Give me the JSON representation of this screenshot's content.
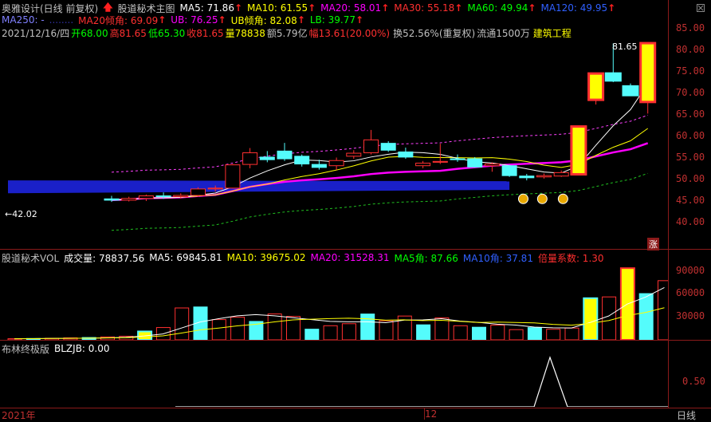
{
  "header": {
    "stock_name": "奥雅设计(日线 前复权)",
    "indicator_name": "股道秘术主图",
    "ma5": "MA5: 71.86",
    "ma10": "MA10: 61.55",
    "ma20": "MA20: 58.01",
    "ma30": "MA30: 55.18",
    "ma60": "MA60: 49.94",
    "ma120": "MA120: 49.95",
    "ma250": "MA250: -",
    "ma250_extra": "MA20倾角...",
    "ma20angle": "MA20倾角: 69.09",
    "ub": "UB: 76.25",
    "ubangle": "UB倾角: 82.08",
    "lb": "LB: 39.77",
    "colors": {
      "ma5": "#ffffff",
      "ma10": "#ffff00",
      "ma20": "#ff00ff",
      "ma30": "#ff3030",
      "ma60": "#00ff00",
      "ma120": "#3060ff",
      "ma250": "#8080ff",
      "up": "#ff3030",
      "down": "#54fcfc"
    }
  },
  "quote": {
    "date": "2021/12/16/四",
    "open": "开68.00",
    "high": "高81.65",
    "low": "低65.30",
    "close": "收81.65",
    "volume": "量78838",
    "amount": "额5.79亿",
    "change": "幅13.61(20.00%)",
    "turnover": "换52.56%(重复权)",
    "float": "流通1500万",
    "sector": "建筑工程"
  },
  "price_axis": {
    "labels": [
      "85.00",
      "80.00",
      "75.00",
      "70.00",
      "65.00",
      "60.00",
      "55.00",
      "50.00",
      "45.00",
      "40.00"
    ],
    "max_label": "81.65",
    "min_label": "42.02",
    "zhang_badge": "涨"
  },
  "chart_data": {
    "type": "candlestick",
    "x_labels": [
      "2021年",
      "12"
    ],
    "candles": [
      {
        "o": 45.5,
        "h": 46.2,
        "l": 44.8,
        "c": 45.2
      },
      {
        "o": 45.2,
        "h": 46.0,
        "l": 44.9,
        "c": 45.6
      },
      {
        "o": 45.6,
        "h": 46.5,
        "l": 45.0,
        "c": 46.2
      },
      {
        "o": 46.2,
        "h": 47.0,
        "l": 45.5,
        "c": 46.0
      },
      {
        "o": 46.0,
        "h": 46.8,
        "l": 45.6,
        "c": 46.3
      },
      {
        "o": 46.3,
        "h": 48.2,
        "l": 46.0,
        "c": 47.8
      },
      {
        "o": 47.8,
        "h": 48.6,
        "l": 47.2,
        "c": 48.0
      },
      {
        "o": 48.0,
        "h": 53.6,
        "l": 47.9,
        "c": 53.4
      },
      {
        "o": 53.5,
        "h": 57.3,
        "l": 52.6,
        "c": 56.2
      },
      {
        "o": 55.2,
        "h": 56.6,
        "l": 54.0,
        "c": 54.6
      },
      {
        "o": 56.6,
        "h": 58.5,
        "l": 54.3,
        "c": 54.8
      },
      {
        "o": 55.4,
        "h": 55.8,
        "l": 53.0,
        "c": 53.6
      },
      {
        "o": 53.5,
        "h": 54.6,
        "l": 52.3,
        "c": 52.8
      },
      {
        "o": 53.2,
        "h": 55.1,
        "l": 52.2,
        "c": 54.4
      },
      {
        "o": 55.4,
        "h": 56.8,
        "l": 54.8,
        "c": 56.1
      },
      {
        "o": 56.2,
        "h": 61.5,
        "l": 55.8,
        "c": 59.2
      },
      {
        "o": 58.4,
        "h": 58.9,
        "l": 56.4,
        "c": 56.8
      },
      {
        "o": 56.4,
        "h": 57.4,
        "l": 54.8,
        "c": 55.2
      },
      {
        "o": 53.2,
        "h": 54.3,
        "l": 52.6,
        "c": 53.8
      },
      {
        "o": 54.0,
        "h": 58.3,
        "l": 53.6,
        "c": 54.2
      },
      {
        "o": 54.8,
        "h": 55.8,
        "l": 54.1,
        "c": 54.6
      },
      {
        "o": 54.8,
        "h": 55.2,
        "l": 52.8,
        "c": 52.9
      },
      {
        "o": 53.2,
        "h": 54.0,
        "l": 51.8,
        "c": 53.6
      },
      {
        "o": 53.2,
        "h": 53.4,
        "l": 50.6,
        "c": 50.9
      },
      {
        "o": 50.8,
        "h": 51.3,
        "l": 49.8,
        "c": 50.4
      },
      {
        "o": 50.6,
        "h": 51.4,
        "l": 50.2,
        "c": 50.9
      },
      {
        "o": 50.8,
        "h": 52.1,
        "l": 50.6,
        "c": 51.6
      },
      {
        "o": 51.2,
        "h": 62.3,
        "l": 51.0,
        "c": 62.3
      },
      {
        "o": 68.5,
        "h": 74.6,
        "l": 67.4,
        "c": 74.6
      },
      {
        "o": 74.6,
        "h": 81.6,
        "l": 72.6,
        "c": 73.0
      },
      {
        "o": 71.6,
        "h": 72.3,
        "l": 69.4,
        "c": 69.6
      },
      {
        "o": 68.0,
        "h": 81.65,
        "l": 65.3,
        "c": 81.65
      }
    ],
    "volume": [
      1500,
      1800,
      2100,
      2600,
      3100,
      3900,
      4800,
      11200,
      16400,
      42500,
      43800,
      27000,
      30200,
      24500,
      34500,
      31200,
      14200,
      18800,
      21500,
      34400,
      25400,
      31700,
      20000,
      29200,
      18800,
      16800,
      19600,
      13600,
      16300,
      14100,
      15700,
      55500,
      57200,
      95500,
      61600,
      78838
    ]
  },
  "volume_panel": {
    "title": "股道秘术VOL",
    "vol": "成交量: 78837.56",
    "ma5": "MA5: 69845.81",
    "ma10": "MA10: 39675.02",
    "ma20": "MA20: 31528.31",
    "ma5angle": "MA5角: 87.66",
    "ma10angle": "MA10角: 37.81",
    "ratio": "倍量系数: 1.30",
    "axis": [
      "90000",
      "60000",
      "30000"
    ]
  },
  "blz_panel": {
    "title": "布林终极版",
    "value": "BLZJB: 0.00",
    "axis": [
      "0.50"
    ]
  },
  "footer": {
    "year_label": "2021年",
    "month_label": "12",
    "period_label": "日线"
  }
}
